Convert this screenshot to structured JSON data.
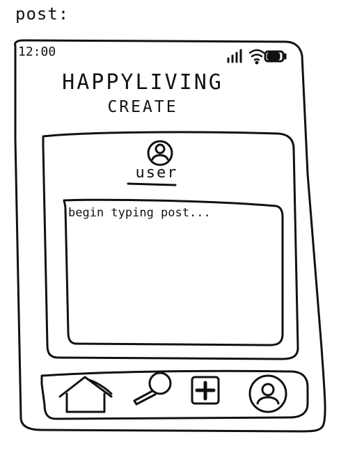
{
  "page_label": "post:",
  "status_bar": {
    "time": "12:00",
    "icons": [
      "signal-icon",
      "wifi-icon",
      "battery-icon"
    ]
  },
  "header": {
    "app_title": "HAPPYLIVING",
    "screen_title": "CREATE"
  },
  "composer": {
    "user_label": "user",
    "avatar_icon": "user-avatar-icon",
    "placeholder": "begin typing post..."
  },
  "bottom_nav": {
    "items": [
      {
        "name": "home",
        "icon": "home-icon"
      },
      {
        "name": "search",
        "icon": "search-icon"
      },
      {
        "name": "create",
        "icon": "plus-icon"
      },
      {
        "name": "profile",
        "icon": "profile-icon"
      }
    ]
  }
}
